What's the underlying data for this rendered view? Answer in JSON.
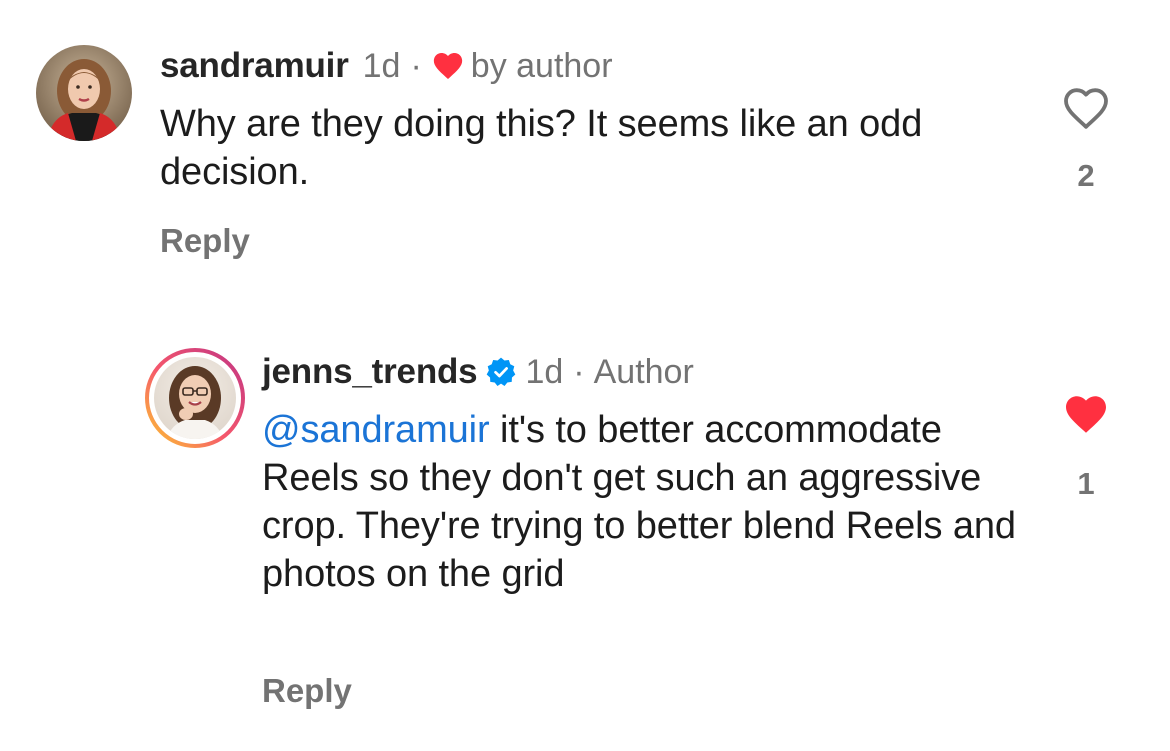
{
  "comments": [
    {
      "username": "sandramuir",
      "time": "1d",
      "separator": "·",
      "liked_by_author_label": "by author",
      "text": "Why are they doing this? It seems like an odd decision.",
      "reply_label": "Reply",
      "like_count": "2",
      "liked": false,
      "avatar_icon": "avatar-photo"
    },
    {
      "username": "jenns_trends",
      "verified": true,
      "time": "1d",
      "separator": "·",
      "author_label": "Author",
      "mention": "@sandramuir",
      "text": " it's to better accommodate Reels so they don't get such an aggressive crop. They're trying to better blend Reels and photos on the grid",
      "reply_label": "Reply",
      "like_count": "1",
      "liked": true,
      "avatar_icon": "avatar-photo-story-ring"
    }
  ],
  "colors": {
    "like_red": "#ff3040",
    "verified_blue": "#0095f6",
    "mention_blue": "#1b74d6",
    "secondary_gray": "#737373",
    "story_ring_start": "#fdc830",
    "story_ring_mid": "#f5576c",
    "story_ring_end": "#c13584"
  }
}
